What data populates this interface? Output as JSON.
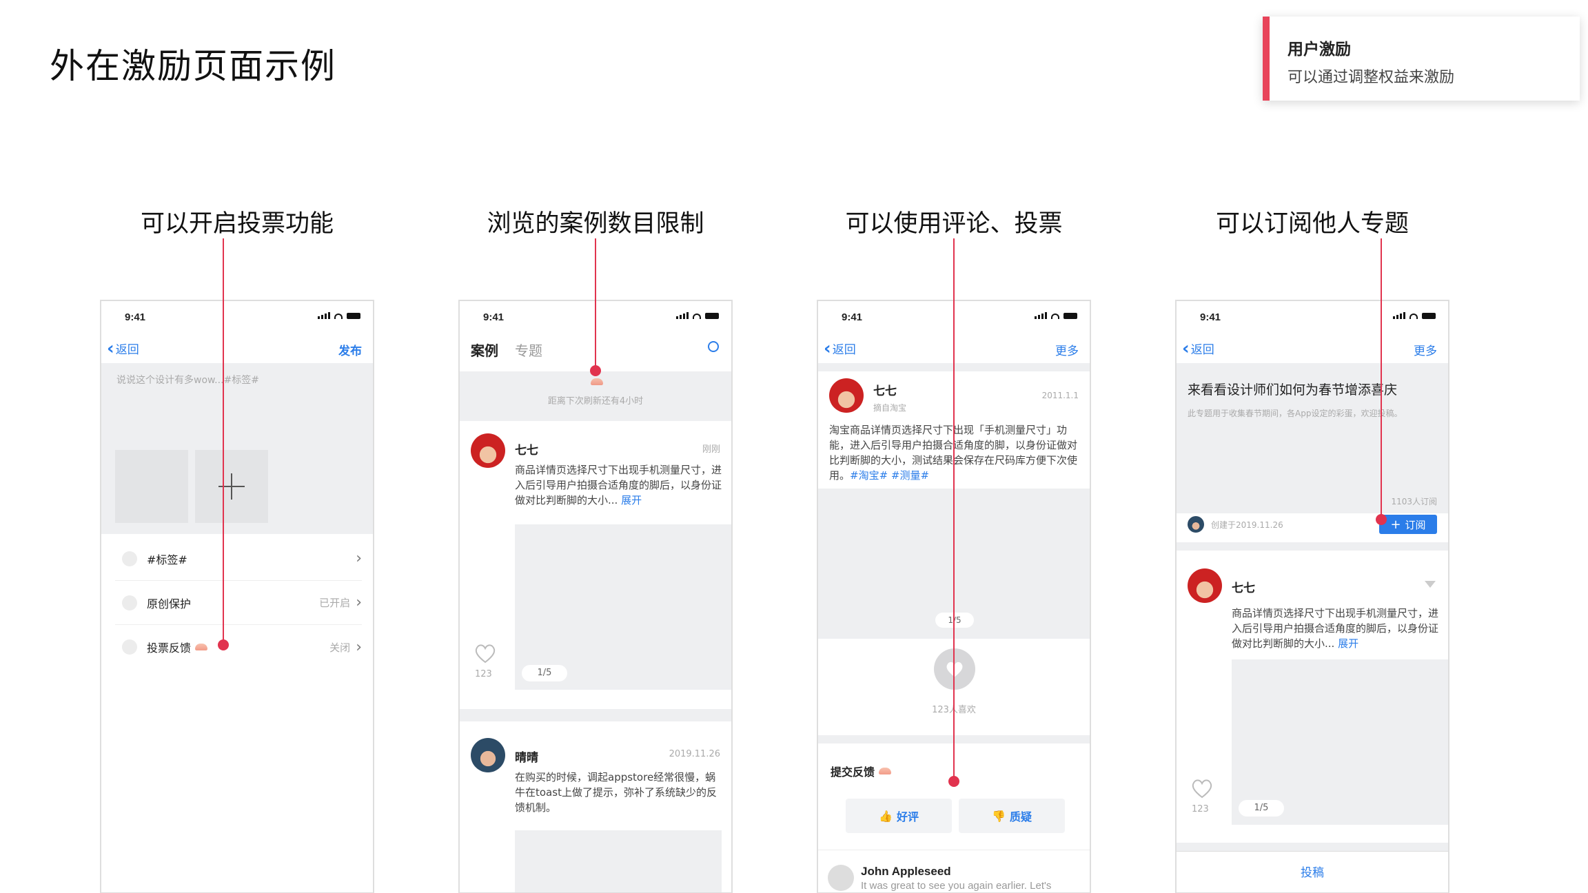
{
  "page": {
    "title": "外在激励页面示例"
  },
  "note": {
    "title": "用户激励",
    "subtitle": "可以通过调整权益来激励"
  },
  "captions": [
    "可以开启投票功能",
    "浏览的案例数目限制",
    "可以使用评论、投票",
    "可以订阅他人专题"
  ],
  "status_time": "9:41",
  "phone1": {
    "back": "返回",
    "publish": "发布",
    "placeholder": "说说这个设计有多wow...#标签#",
    "rows": [
      {
        "label": "#标签#",
        "value": ""
      },
      {
        "label": "原创保护",
        "value": "已开启"
      },
      {
        "label": "投票反馈",
        "value": "关闭"
      }
    ]
  },
  "phone2": {
    "tab_active": "案例",
    "tab_other": "专题",
    "refresh": "距离下次刷新还有4小时",
    "post1": {
      "name": "七七",
      "time": "刚刚",
      "text": "商品详情页选择尺寸下出现手机测量尺寸，进入后引导用户拍摄合适角度的脚后，以身份证做对比判断脚的大小...",
      "more": "展开",
      "likes": "123",
      "pager": "1/5"
    },
    "post2": {
      "name": "晴晴",
      "time": "2019.11.26",
      "text": "在购买的时候，调起appstore经常很慢，蜗牛在toast上做了提示，弥补了系统缺少的反馈机制。"
    }
  },
  "phone3": {
    "back": "返回",
    "more": "更多",
    "name": "七七",
    "sub": "摘自淘宝",
    "date": "2011.1.1",
    "text": "淘宝商品详情页选择尺寸下出现「手机测量尺寸」功能，进入后引导用户拍摄合适角度的脚，以身份证做对比判断脚的大小，测试结果会保存在尺码库方便下次使用。",
    "tags": "#淘宝# #测量#",
    "pager": "1/5",
    "likes": "123人喜欢",
    "feedback": "提交反馈",
    "good": "好评",
    "doubt": "质疑",
    "commenter": "John Appleseed",
    "comment": "It was great to see you again earlier. Let's"
  },
  "phone4": {
    "back": "返回",
    "more": "更多",
    "topic_title": "来看看设计师们如何为春节增添喜庆",
    "topic_desc": "此专题用于收集春节期间，各App设定的彩蛋，欢迎投稿。",
    "subs": "1103人订阅",
    "created": "创建于2019.11.26",
    "subscribe": "订阅",
    "name": "七七",
    "text": "商品详情页选择尺寸下出现手机测量尺寸，进入后引导用户拍摄合适角度的脚后，以身份证做对比判断脚的大小...",
    "expand": "展开",
    "likes": "123",
    "pager": "1/5",
    "contribute": "投稿"
  }
}
